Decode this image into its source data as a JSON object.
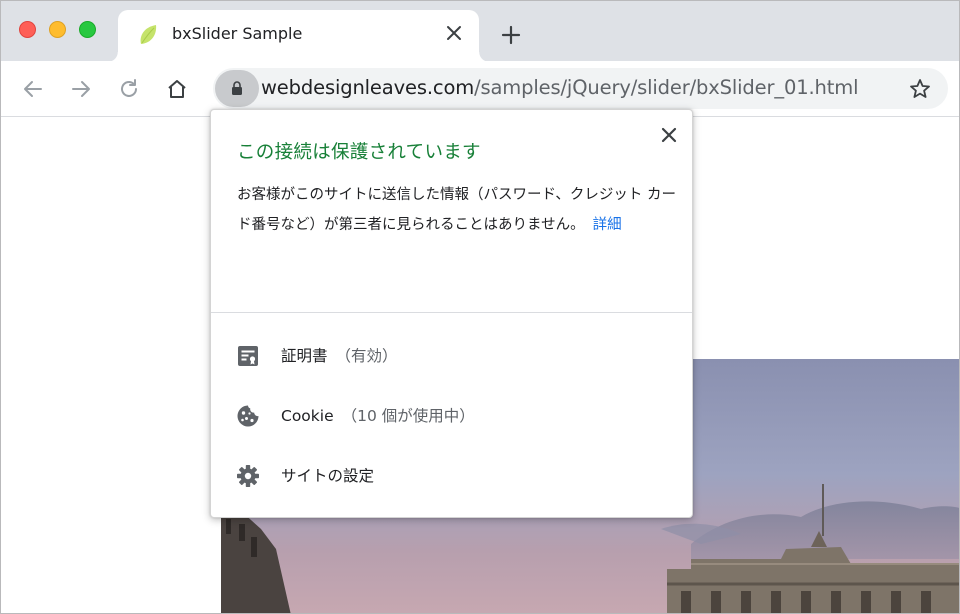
{
  "tab": {
    "title": "bxSlider Sample"
  },
  "address_bar": {
    "url_host": "webdesignleaves.com",
    "url_path": "/samples/jQuery/slider/bxSlider_01.html"
  },
  "site_info_popup": {
    "title": "この接続は保護されています",
    "description": "お客様がこのサイトに送信した情報（パスワード、クレジット カード番号など）が第三者に見られることはありません。",
    "learn_more_link": "詳細",
    "rows": [
      {
        "label": "証明書",
        "sub": "（有効）",
        "icon": "certificate-icon"
      },
      {
        "label": "Cookie",
        "sub": "（10 個が使用中）",
        "icon": "cookie-icon"
      },
      {
        "label": "サイトの設定",
        "sub": "",
        "icon": "gear-icon"
      }
    ]
  },
  "colors": {
    "secure_title": "#188038",
    "link": "#1a73e8",
    "tab_bar": "#dee1e6",
    "omnibox": "#f1f3f4"
  }
}
